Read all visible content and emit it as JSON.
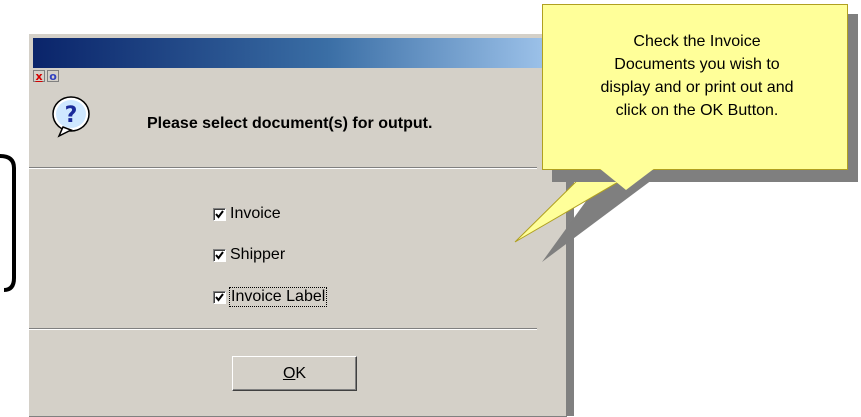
{
  "dialog": {
    "controls": {
      "close_glyph": "x",
      "min_glyph": "o"
    },
    "icon": "question-icon",
    "prompt": "Please select document(s) for output.",
    "options": [
      {
        "label": "Invoice",
        "checked": true
      },
      {
        "label": "Shipper",
        "checked": true
      },
      {
        "label": "Invoice Label",
        "checked": true,
        "focused": true
      }
    ],
    "ok_mnemonic": "O",
    "ok_rest": "K"
  },
  "callout": {
    "text": "Check the Invoice\nDocuments you wish to\ndisplay and or print out and\nclick on the OK Button."
  },
  "colors": {
    "dialog_bg": "#d4d0c8",
    "titlebar_dark": "#0a246a",
    "callout_bg": "#ffff99",
    "close_red": "#d40000"
  }
}
